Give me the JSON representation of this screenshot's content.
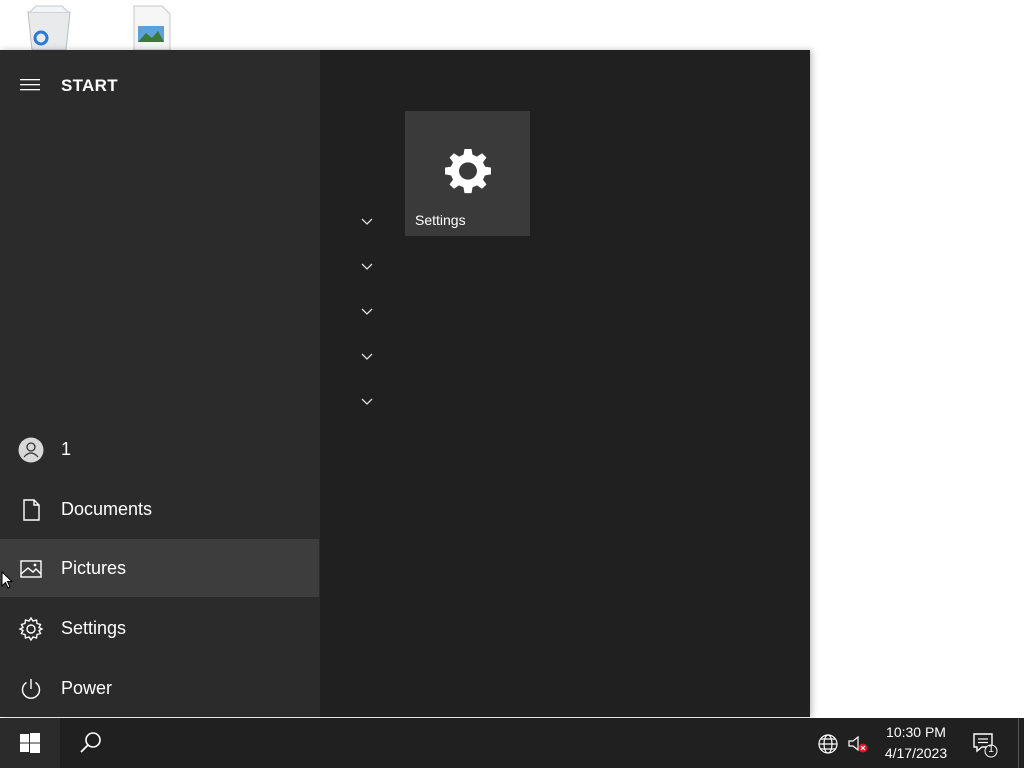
{
  "desktop": {
    "icons": [
      {
        "icon": "recycle-bin-icon"
      },
      {
        "icon": "image-file-icon"
      }
    ]
  },
  "start_menu": {
    "title": "START",
    "rail": [
      {
        "label": "1",
        "icon": "user-avatar-icon"
      },
      {
        "label": "Documents",
        "icon": "document-icon"
      },
      {
        "label": "Pictures",
        "icon": "pictures-icon",
        "hovered": true
      },
      {
        "label": "Settings",
        "icon": "gear-icon"
      },
      {
        "label": "Power",
        "icon": "power-icon"
      }
    ],
    "group_chevrons": 5,
    "tile": {
      "label": "Settings",
      "icon": "gear-icon"
    }
  },
  "taskbar": {
    "clock": {
      "time": "10:30 PM",
      "date": "4/17/2023"
    },
    "notification_count": "1",
    "tray": [
      "network-globe-icon",
      "volume-muted-icon"
    ]
  },
  "colors": {
    "menu_bg": "#202020",
    "rail_bg": "#2b2b2b",
    "hover_bg": "#3d3d3d",
    "tile_bg": "#3a3a3a",
    "taskbar_bg": "#202020",
    "mute_badge": "#e81123"
  }
}
